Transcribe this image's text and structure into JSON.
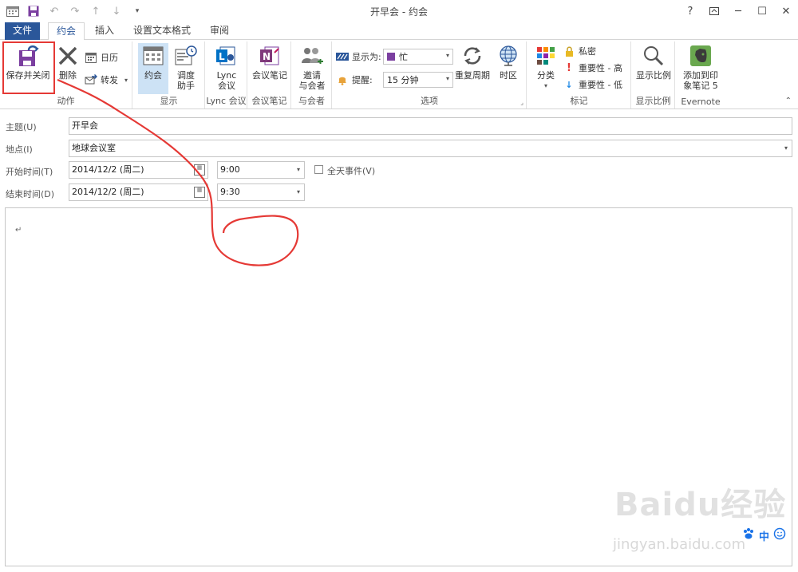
{
  "window": {
    "title": "开早会 - 约会",
    "controls": {
      "help": "?",
      "restore_ribbon": "⊼",
      "minimize": "─",
      "maximize": "☐",
      "close": "✕"
    }
  },
  "qat": {
    "icons": [
      "calendar-icon",
      "save-icon",
      "undo-icon",
      "redo-icon",
      "up-arrow-icon",
      "down-arrow-icon",
      "customize-icon"
    ]
  },
  "tabs": {
    "file": "文件",
    "appointment": "约会",
    "insert": "插入",
    "format": "设置文本格式",
    "review": "审阅"
  },
  "ribbon": {
    "actions": {
      "save_close": "保存并关闭",
      "delete": "删除",
      "calendar": "日历",
      "forward": "转发",
      "group_label": "动作"
    },
    "show": {
      "appointment": "约会",
      "scheduling_line1": "调度",
      "scheduling_line2": "助手",
      "group_label": "显示"
    },
    "lync": {
      "line1": "Lync",
      "line2": "会议",
      "group_label": "Lync 会议"
    },
    "meeting_notes": {
      "label": "会议笔记",
      "group_label": "会议笔记"
    },
    "attendees": {
      "line1": "邀请",
      "line2": "与会者",
      "group_label": "与会者"
    },
    "options": {
      "show_as_label": "显示为:",
      "show_as_value": "忙",
      "reminder_label": "提醒:",
      "reminder_value": "15 分钟",
      "recurrence": "重复周期",
      "time_zones": "时区",
      "group_label": "选项"
    },
    "tags": {
      "categorize": "分类",
      "private": "私密",
      "high_importance": "重要性 - 高",
      "low_importance": "重要性 - 低",
      "group_label": "标记"
    },
    "zoom": {
      "label": "显示比例",
      "group_label": "显示比例"
    },
    "evernote": {
      "line1": "添加到印",
      "line2": "象笔记 5",
      "group_label": "Evernote"
    }
  },
  "form": {
    "subject_label": "主题(U)",
    "subject_value": "开早会",
    "location_label": "地点(I)",
    "location_value": "地球会议室",
    "start_label": "开始时间(T)",
    "start_date": "2014/12/2 (周二)",
    "start_time": "9:00",
    "end_label": "结束时间(D)",
    "end_date": "2014/12/2 (周二)",
    "end_time": "9:30",
    "all_day_label": "全天事件(V)",
    "all_day_checked": false
  },
  "body": {
    "pilcrow": "↵"
  },
  "watermark": {
    "brand": "Baidu经验",
    "url": "jingyan.baidu.com"
  },
  "ime": {
    "mode": "中"
  },
  "colors": {
    "accent": "#2b579a",
    "annotation": "#e53935"
  }
}
